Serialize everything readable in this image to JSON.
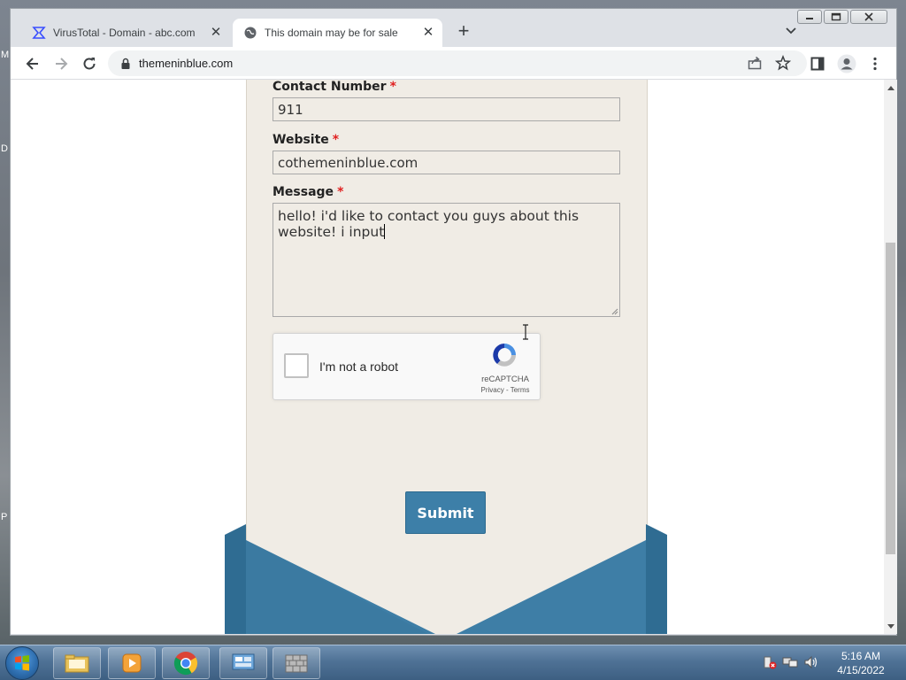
{
  "browser": {
    "tabs": [
      {
        "title": "VirusTotal - Domain - abc.com",
        "active": false
      },
      {
        "title": "This domain may be for sale",
        "active": true
      }
    ],
    "new_tab_glyph": "+",
    "close_glyph": "✕",
    "url": "themeninblue.com",
    "icons": [
      "back-icon",
      "forward-icon",
      "reload-icon",
      "lock-icon",
      "share-icon",
      "star-icon",
      "side-panel-icon",
      "profile-icon",
      "menu-icon"
    ]
  },
  "form": {
    "contact": {
      "label": "Contact Number",
      "required_mark": "*",
      "value": "911"
    },
    "website": {
      "label": "Website",
      "required_mark": "*",
      "value": "cothemeninblue.com"
    },
    "message": {
      "label": "Message",
      "required_mark": "*",
      "value": "hello! i'd like to contact you guys about this website! i input"
    },
    "recaptcha": {
      "label": "I'm not a robot",
      "brand": "reCAPTCHA",
      "links": "Privacy - Terms"
    },
    "submit_label": "Submit"
  },
  "colors": {
    "card_bg": "#f0ece5",
    "submit_bg": "#3d7fa8",
    "envelope": "#3d7ba0"
  },
  "desktop": {
    "edge_labels": [
      "M",
      "D",
      "P"
    ]
  },
  "taskbar": {
    "items": [
      "folder-icon",
      "media-player-icon",
      "chrome-icon",
      "control-panel-icon",
      "wall-icon"
    ],
    "time": "5:16 AM",
    "date": "4/15/2022"
  }
}
